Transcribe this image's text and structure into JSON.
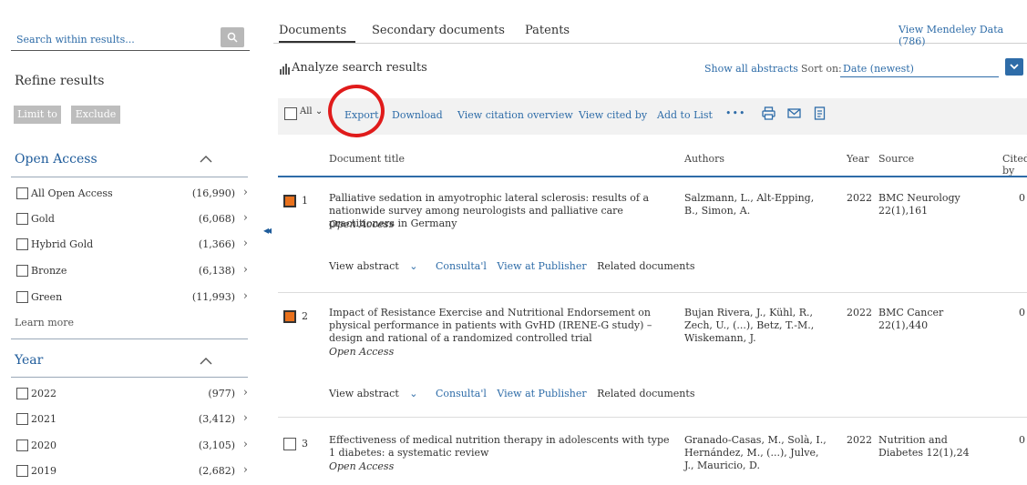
{
  "sidebar": {
    "search_placeholder": "Search within results...",
    "refine_title": "Refine results",
    "limit_label": "Limit to",
    "exclude_label": "Exclude",
    "open_access": {
      "title": "Open Access",
      "items": [
        {
          "label": "All Open Access",
          "count": "(16,990)"
        },
        {
          "label": "Gold",
          "count": "(6,068)"
        },
        {
          "label": "Hybrid Gold",
          "count": "(1,366)"
        },
        {
          "label": "Bronze",
          "count": "(6,138)"
        },
        {
          "label": "Green",
          "count": "(11,993)"
        }
      ],
      "learn_more": "Learn more"
    },
    "year": {
      "title": "Year",
      "items": [
        {
          "label": "2022",
          "count": "(977)"
        },
        {
          "label": "2021",
          "count": "(3,412)"
        },
        {
          "label": "2020",
          "count": "(3,105)"
        },
        {
          "label": "2019",
          "count": "(2,682)"
        }
      ]
    }
  },
  "tabs": {
    "documents": "Documents",
    "secondary": "Secondary documents",
    "patents": "Patents"
  },
  "mendeley_link": "View Mendeley Data (786)",
  "analyze_label": "Analyze search results",
  "show_abstracts": "Show all abstracts",
  "sort_on_label": "Sort on:",
  "sort_value": "Date (newest)",
  "toolbar": {
    "all_label": "All",
    "export": "Export",
    "download": "Download",
    "citation_overview": "View citation overview",
    "cited_by": "View cited by",
    "add_to_list": "Add to List",
    "more": "•••"
  },
  "columns": {
    "title": "Document title",
    "authors": "Authors",
    "year": "Year",
    "source": "Source",
    "cited_by": "Cited by"
  },
  "row_actions": {
    "view_abstract": "View abstract",
    "consultal": "Consulta'l",
    "view_publisher": "View at Publisher",
    "related": "Related documents"
  },
  "rows": [
    {
      "num": "1",
      "checked": true,
      "title": "Palliative sedation in amyotrophic lateral sclerosis: results of a nationwide survey among neurologists and palliative care practitioners in Germany",
      "access": "Open Access",
      "authors": "Salzmann, L., Alt-Epping, B., Simon, A.",
      "year": "2022",
      "source": "BMC Neurology 22(1),161",
      "cited": "0"
    },
    {
      "num": "2",
      "checked": true,
      "title": "Impact of Resistance Exercise and Nutritional Endorsement on physical performance in patients with GvHD (IRENE-G study) – design and rational of a randomized controlled trial",
      "access": "Open Access",
      "authors": "Bujan Rivera, J., Kühl, R., Zech, U., (...), Betz, T.-M., Wiskemann, J.",
      "year": "2022",
      "source": "BMC Cancer 22(1),440",
      "cited": "0"
    },
    {
      "num": "3",
      "checked": false,
      "title": "Effectiveness of medical nutrition therapy in adolescents with type 1 diabetes: a systematic review",
      "access": "Open Access",
      "authors": "Granado-Casas, M., Solà, I., Hernández, M., (...), Julve, J., Mauricio, D.",
      "year": "2022",
      "source": "Nutrition and Diabetes 12(1),24",
      "cited": "0"
    }
  ],
  "colors": {
    "link": "#2e6ca8",
    "checked": "#e9711c",
    "highlight_circle": "#e01b1b"
  }
}
